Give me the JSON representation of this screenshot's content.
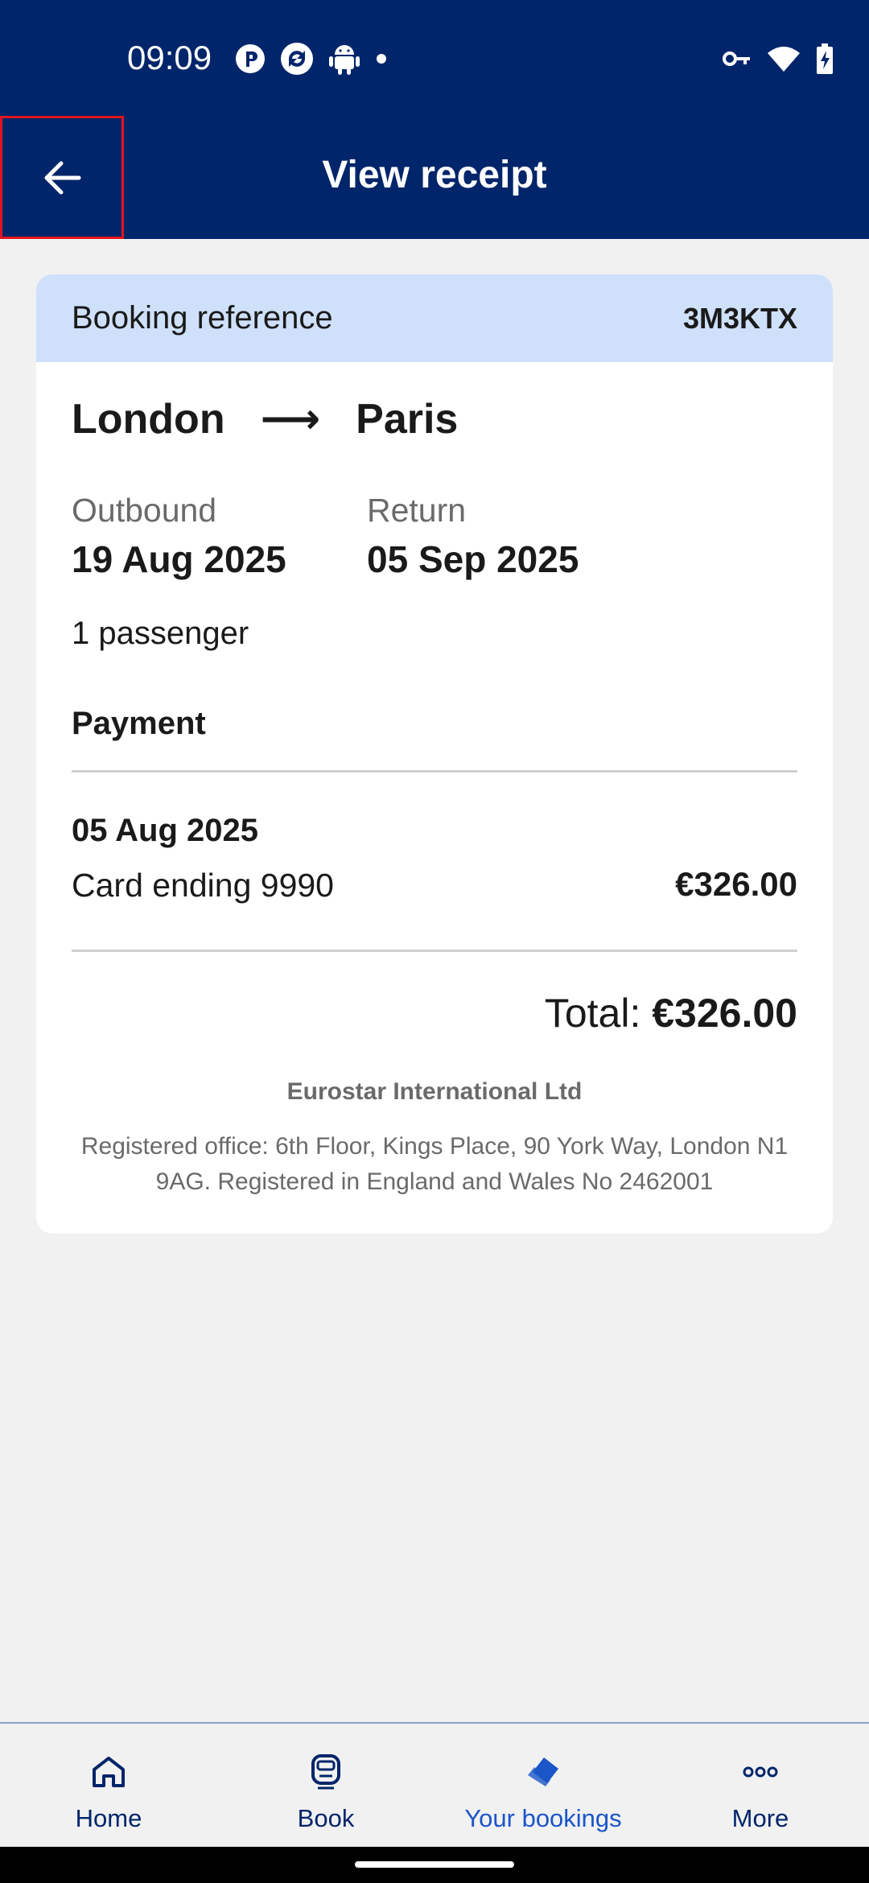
{
  "status_bar": {
    "time": "09:09"
  },
  "header": {
    "title": "View receipt",
    "back_icon": "arrow-left-icon"
  },
  "receipt": {
    "booking_reference_label": "Booking reference",
    "booking_reference": "3M3KTX",
    "origin": "London",
    "route_arrow": "⟶",
    "destination": "Paris",
    "outbound_label": "Outbound",
    "outbound_date": "19 Aug 2025",
    "return_label": "Return",
    "return_date": "05 Sep 2025",
    "passengers": "1 passenger",
    "payment_heading": "Payment",
    "payment_date": "05 Aug 2025",
    "payment_method": "Card ending 9990",
    "payment_amount": "€326.00",
    "total_label": "Total: ",
    "total_amount": "€326.00",
    "company_name": "Eurostar International Ltd",
    "registered_office": "Registered office: 6th Floor, Kings Place, 90 York Way, London N1 9AG. Registered in England and Wales No 2462001"
  },
  "bottom_nav": {
    "items": [
      {
        "label": "Home",
        "icon": "home-icon",
        "active": false
      },
      {
        "label": "Book",
        "icon": "train-icon",
        "active": false
      },
      {
        "label": "Your bookings",
        "icon": "tickets-icon",
        "active": true
      },
      {
        "label": "More",
        "icon": "more-dots-icon",
        "active": false
      }
    ]
  },
  "colors": {
    "header_bg": "#00256a",
    "reference_bg": "#cfe0fb",
    "active_nav": "#1a56c8",
    "back_highlight": "#e0161e"
  }
}
